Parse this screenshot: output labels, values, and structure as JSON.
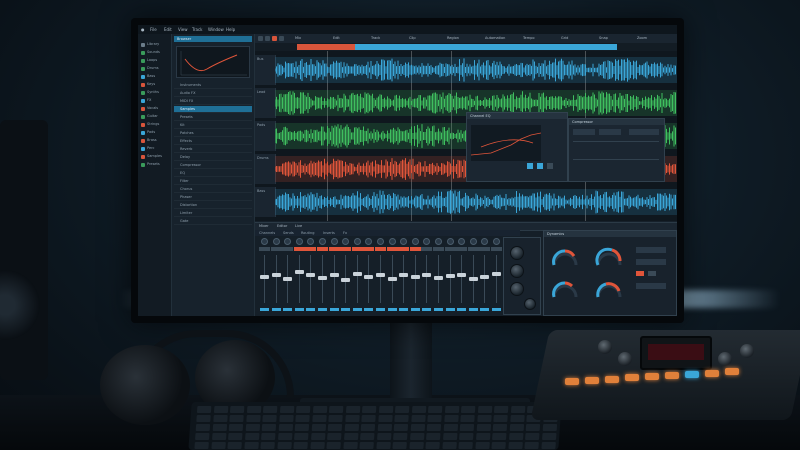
{
  "scene": {
    "description_labels": {
      "monitor": "monitor",
      "headphones": "headphones",
      "keyboard": "keyboard",
      "controller": "controller"
    }
  },
  "daw": {
    "menu": [
      "File",
      "Edit",
      "View",
      "Track",
      "Window",
      "Help"
    ],
    "sidebar_items": [
      "Library",
      "Sounds",
      "Loops",
      "Drums",
      "Bass",
      "Keys",
      "Synths",
      "FX",
      "Vocals",
      "Guitar",
      "Strings",
      "Pads",
      "Brass",
      "Perc",
      "Samples",
      "Presets"
    ],
    "sidebar_colors": [
      "#6b7c89",
      "#3a9b5b",
      "#3a9b5b",
      "#3a9b5b",
      "#3aa6d8",
      "#d8553b",
      "#3a9b5b",
      "#3aa6d8",
      "#d8553b",
      "#3a9b5b",
      "#d8553b",
      "#3aa6d8",
      "#d8553b",
      "#3aa6d8",
      "#d8553b",
      "#3a9b5b"
    ],
    "browser": {
      "header": "Browser",
      "rows": [
        "Instruments",
        "Audio FX",
        "MIDI FX",
        "Samples",
        "Presets",
        "Kit",
        "Patches",
        "Effects",
        "Reverb",
        "Delay",
        "Compressor",
        "EQ",
        "Filter",
        "Chorus",
        "Phaser",
        "Distortion",
        "Limiter",
        "Gate"
      ],
      "selected_index": 3
    },
    "toolbar": {
      "labels": [
        "Mix",
        "Edit",
        "Track",
        "Clip",
        "Region",
        "Automation",
        "Tempo",
        "Grid",
        "Snap",
        "Zoom"
      ]
    },
    "tracks": [
      {
        "name": "Bus",
        "color": "#3aa6d8"
      },
      {
        "name": "Lead",
        "color": "#3fbf5f"
      },
      {
        "name": "Pads",
        "color": "#3fbf5f"
      },
      {
        "name": "Drums",
        "color": "#e0553a"
      },
      {
        "name": "Bass",
        "color": "#3aa6d8"
      }
    ],
    "panels": {
      "eq": {
        "title": "Channel EQ"
      },
      "comp": {
        "title": "Compressor"
      }
    },
    "mixer": {
      "tabs": [
        "Mixer",
        "Editor",
        "Live"
      ],
      "subtabs": [
        "Channels",
        "Sends",
        "Routing",
        "Inserts",
        "Fx"
      ],
      "strip_count": 21,
      "dynamics_title": "Dynamics",
      "fader_levels": [
        0.55,
        0.6,
        0.5,
        0.65,
        0.58,
        0.52,
        0.6,
        0.48,
        0.62,
        0.55,
        0.6,
        0.5,
        0.58,
        0.54,
        0.6,
        0.52,
        0.57,
        0.6,
        0.5,
        0.55,
        0.62
      ]
    }
  }
}
